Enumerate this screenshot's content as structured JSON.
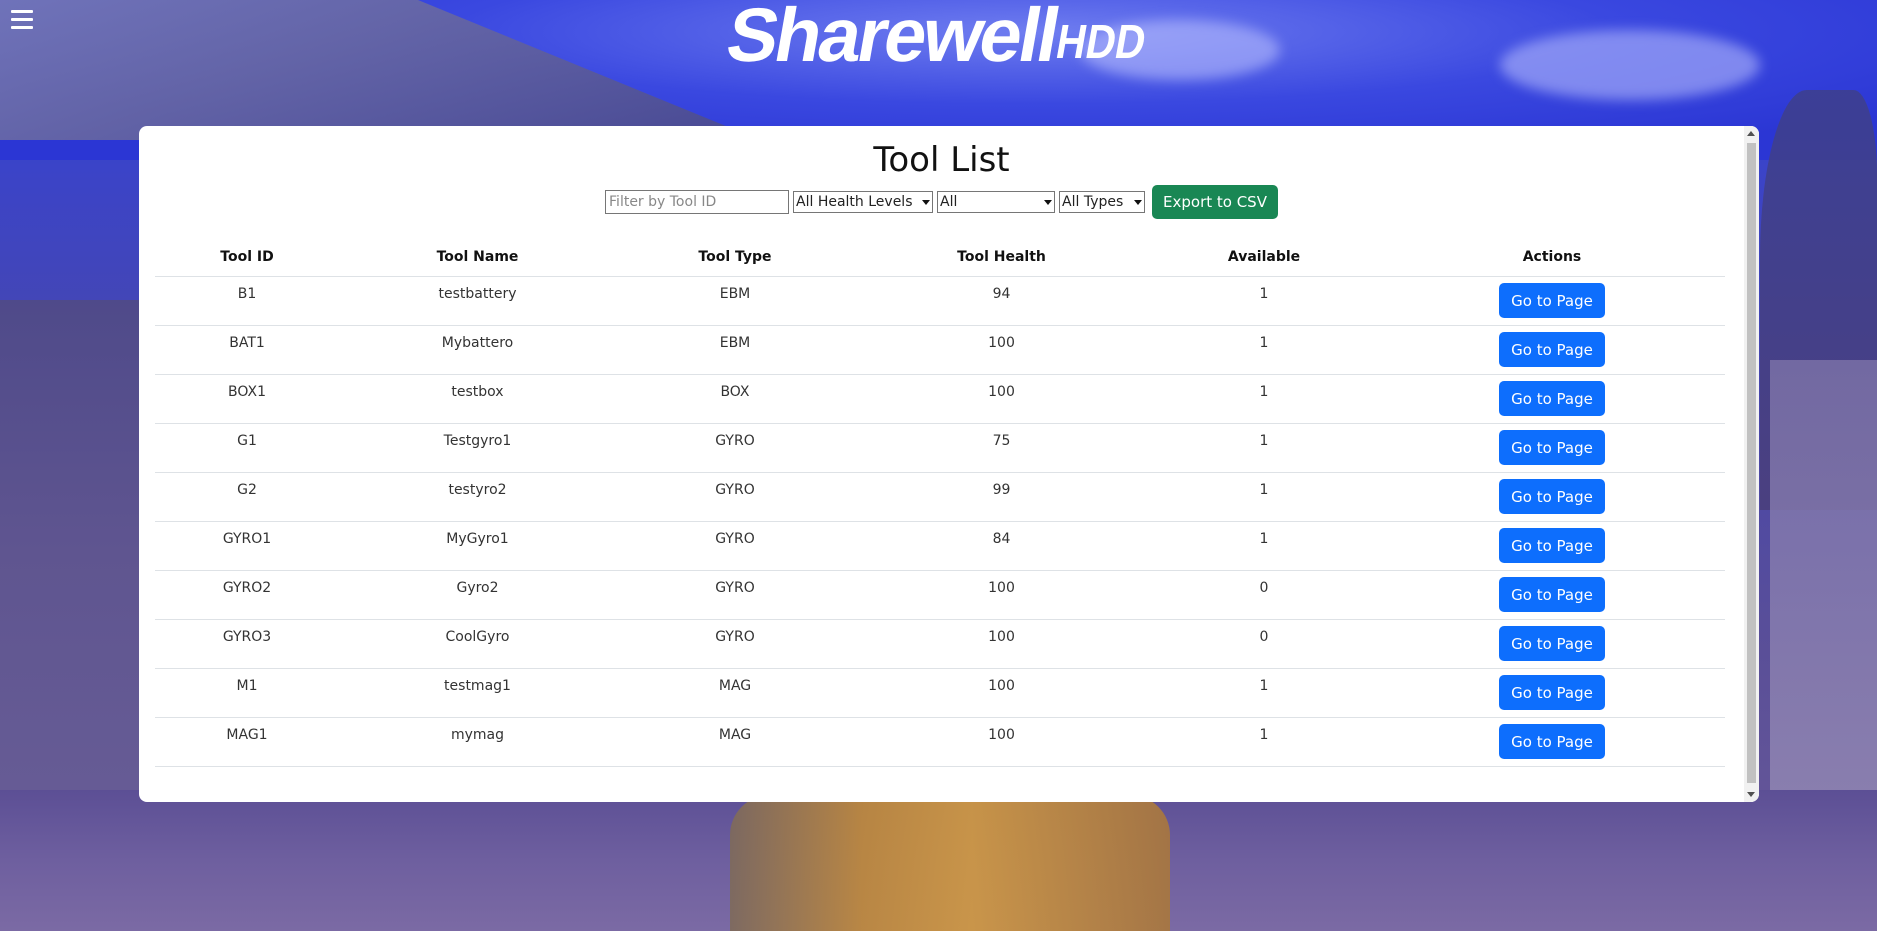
{
  "app": {
    "logo_main": "Sharewell",
    "logo_sub": "HDD"
  },
  "page": {
    "title": "Tool List"
  },
  "filters": {
    "tool_id_placeholder": "Filter by Tool ID",
    "health_selected": "All Health Levels",
    "available_selected": "All",
    "types_selected": "All Types",
    "export_label": "Export to CSV"
  },
  "table": {
    "headers": [
      "Tool ID",
      "Tool Name",
      "Tool Type",
      "Tool Health",
      "Available",
      "Actions"
    ],
    "action_label": "Go to Page",
    "rows": [
      {
        "id": "B1",
        "name": "testbattery",
        "type": "EBM",
        "health": "94",
        "available": "1"
      },
      {
        "id": "BAT1",
        "name": "Mybattero",
        "type": "EBM",
        "health": "100",
        "available": "1"
      },
      {
        "id": "BOX1",
        "name": "testbox",
        "type": "BOX",
        "health": "100",
        "available": "1"
      },
      {
        "id": "G1",
        "name": "Testgyro1",
        "type": "GYRO",
        "health": "75",
        "available": "1"
      },
      {
        "id": "G2",
        "name": "testyro2",
        "type": "GYRO",
        "health": "99",
        "available": "1"
      },
      {
        "id": "GYRO1",
        "name": "MyGyro1",
        "type": "GYRO",
        "health": "84",
        "available": "1"
      },
      {
        "id": "GYRO2",
        "name": "Gyro2",
        "type": "GYRO",
        "health": "100",
        "available": "0"
      },
      {
        "id": "GYRO3",
        "name": "CoolGyro",
        "type": "GYRO",
        "health": "100",
        "available": "0"
      },
      {
        "id": "M1",
        "name": "testmag1",
        "type": "MAG",
        "health": "100",
        "available": "1"
      },
      {
        "id": "MAG1",
        "name": "mymag",
        "type": "MAG",
        "health": "100",
        "available": "1"
      }
    ]
  },
  "colors": {
    "primary": "#0d6efd",
    "success": "#198754",
    "background_tint": "#3b44c8"
  },
  "icons": {
    "menu": "hamburger-menu-icon"
  }
}
